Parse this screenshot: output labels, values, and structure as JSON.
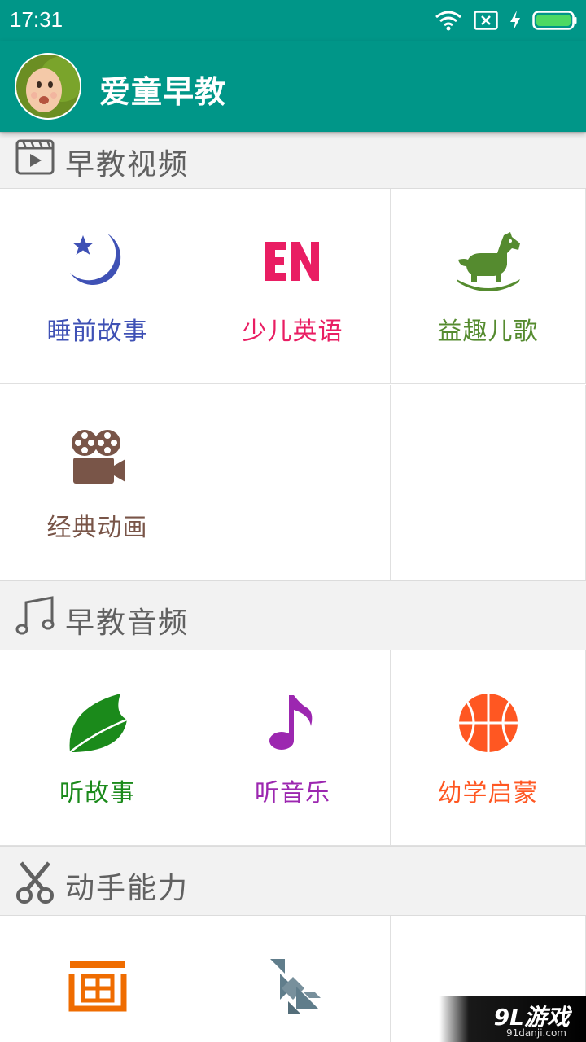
{
  "status_bar": {
    "time": "17:31",
    "icons": [
      "wifi-icon",
      "sim-no-signal-icon",
      "charging-icon",
      "battery-icon"
    ]
  },
  "app_bar": {
    "title": "爱童早教",
    "avatar": "baby-avatar"
  },
  "colors": {
    "primary": "#009688",
    "section_bg": "#f2f2f2",
    "section_text": "#616161"
  },
  "sections": [
    {
      "title": "早教视频",
      "icon": "video-clapper-icon",
      "items": [
        {
          "label": "睡前故事",
          "icon": "moon-star-icon",
          "color": "#3f51b5"
        },
        {
          "label": "少儿英语",
          "icon": "en-letters-icon",
          "color": "#e91e63"
        },
        {
          "label": "益趣儿歌",
          "icon": "rocking-horse-icon",
          "color": "#558b2f"
        },
        {
          "label": "经典动画",
          "icon": "movie-camera-icon",
          "color": "#795548"
        }
      ]
    },
    {
      "title": "早教音频",
      "icon": "music-notes-icon",
      "items": [
        {
          "label": "听故事",
          "icon": "leaf-icon",
          "color": "#1b8a1b"
        },
        {
          "label": "听音乐",
          "icon": "music-note-icon",
          "color": "#9c27b0"
        },
        {
          "label": "幼学启蒙",
          "icon": "basketball-icon",
          "color": "#ff5722"
        }
      ]
    },
    {
      "title": "动手能力",
      "icon": "scissors-icon",
      "items": [
        {
          "label": "画",
          "icon": "draw-character-icon",
          "color": "#ef6c00"
        },
        {
          "label": "",
          "icon": "tangram-icon",
          "color": "#607d8b"
        }
      ]
    }
  ],
  "watermark": {
    "brand": "9L游戏",
    "url": "91danji.com"
  }
}
